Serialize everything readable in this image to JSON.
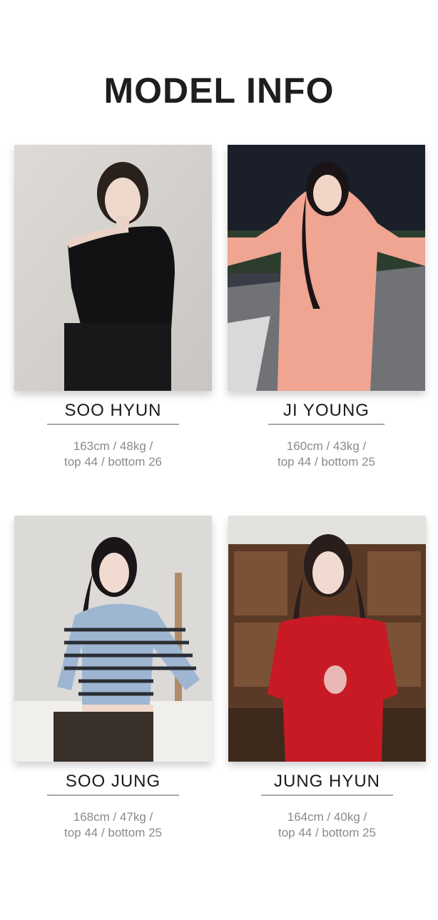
{
  "page": {
    "title": "MODEL INFO"
  },
  "models": [
    {
      "name": "SOO HYUN",
      "line1": "163cm / 48kg /",
      "line2": "top 44 / bottom 26"
    },
    {
      "name": "JI YOUNG",
      "line1": "160cm / 43kg /",
      "line2": "top 44 / bottom 25"
    },
    {
      "name": "SOO JUNG",
      "line1": "168cm / 47kg /",
      "line2": "top 44 / bottom 25"
    },
    {
      "name": "JUNG HYUN",
      "line1": "164cm / 40kg /",
      "line2": "top 44 / bottom 25"
    }
  ]
}
